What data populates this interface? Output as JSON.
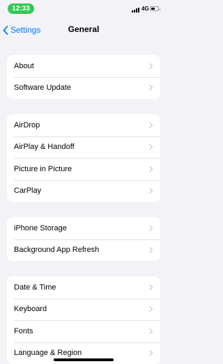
{
  "status": {
    "time": "12:33",
    "network": "4G"
  },
  "nav": {
    "back_label": "Settings",
    "title": "General"
  },
  "groups": [
    {
      "items": [
        {
          "label": "About"
        },
        {
          "label": "Software Update"
        }
      ]
    },
    {
      "items": [
        {
          "label": "AirDrop"
        },
        {
          "label": "AirPlay & Handoff"
        },
        {
          "label": "Picture in Picture"
        },
        {
          "label": "CarPlay"
        }
      ]
    },
    {
      "items": [
        {
          "label": "iPhone Storage"
        },
        {
          "label": "Background App Refresh"
        }
      ]
    },
    {
      "items": [
        {
          "label": "Date & Time"
        },
        {
          "label": "Keyboard"
        },
        {
          "label": "Fonts"
        },
        {
          "label": "Language & Region"
        }
      ]
    }
  ],
  "colors": {
    "accent": "#007aff",
    "time_pill": "#35c759",
    "background": "#f2f2f7"
  }
}
